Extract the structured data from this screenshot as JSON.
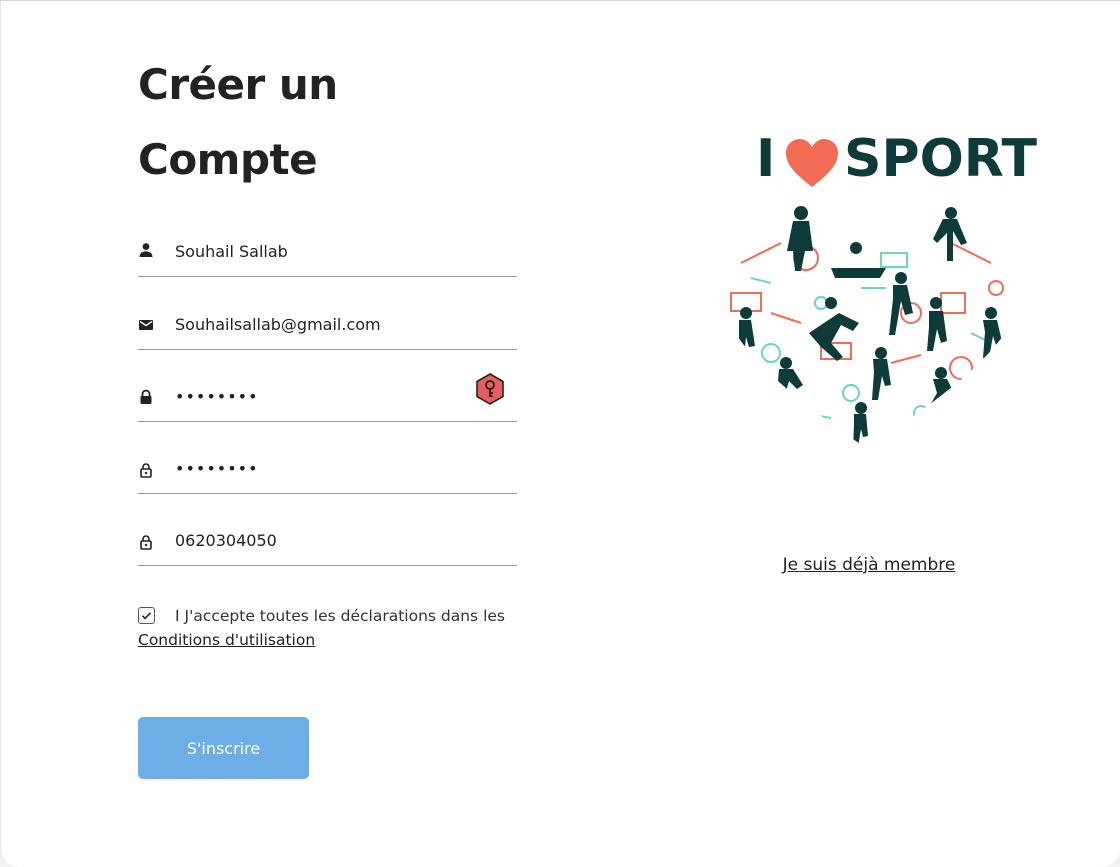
{
  "form": {
    "title_line1": "Créer un",
    "title_line2": "Compte",
    "name": {
      "value": "Souhail Sallab",
      "icon": "person-icon"
    },
    "email": {
      "value": "Souhailsallab@gmail.com",
      "icon": "mail-icon"
    },
    "password": {
      "value": "••••••••",
      "icon": "lock-icon"
    },
    "password_confirm": {
      "value": "••••••••",
      "icon": "lock-outline-icon"
    },
    "phone": {
      "value": "0620304050",
      "icon": "lock-outline-icon"
    },
    "terms_text": "I J'accepte toutes les déclarations dans les",
    "terms_link": "Conditions d'utilisation",
    "terms_checked": true,
    "submit_label": "S'inscrire"
  },
  "aside": {
    "logo_i": "I",
    "logo_sport": "SPORT",
    "member_link": "Je suis déjà membre"
  },
  "colors": {
    "accent": "#6daee6",
    "logo_dark": "#0d3b3a",
    "logo_coral": "#f26b55",
    "logo_teal": "#6fd3c3",
    "key_badge": "#e85d5d"
  }
}
